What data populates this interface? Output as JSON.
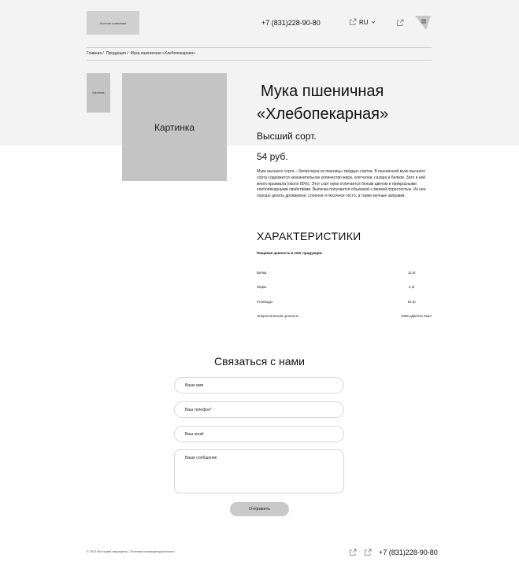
{
  "header": {
    "logo_text": "Логотип компании",
    "phone": "+7 (831)228-90-80",
    "lang": "RU"
  },
  "breadcrumb": {
    "items": [
      "Главная /",
      "Продукция /",
      "Мука пшеничная «Хлебопекарная»"
    ]
  },
  "gallery": {
    "thumb_label": "Картинка",
    "main_label": "Картинка"
  },
  "product": {
    "title_line1": "Мука пшеничная",
    "title_line2": "«Хлебопекарная»",
    "grade": "Высший сорт.",
    "price": "54 руб.",
    "description": "Мука высшего сорта – белая мука из пшеницы твёрдых сортов. В пшеничной муке высшего сорта содержится незначительное количество жира, клетчатки, сахара и белков. Зато в ней много крахмала (около 80%). Этот сорт муки отличается белым цветом и прекрасными хлебопекарными свойствами. Выпечка получается объемной с мелкой пористостью. Из нее хорошо делать дрожжевое, слоеное и песочное тесто, а также мучные заправки."
  },
  "characteristics": {
    "title": "ХАРАКТЕРИСТИКИ",
    "subtitle": "Пищевая ценность в 100г продукции:",
    "rows": [
      {
        "name": "Белки",
        "value": "11,5г"
      },
      {
        "name": "Жиры",
        "value": "2,2г"
      },
      {
        "name": "Углеводы",
        "value": "61,5г"
      },
      {
        "name": "Энергетическая ценность",
        "value": "1306 кДж/312 Ккал"
      }
    ]
  },
  "contact": {
    "title": "Связаться с нами",
    "name_placeholder": "Ваше имя",
    "phone_placeholder": "Ваш телефон*",
    "email_placeholder": "Ваш email",
    "message_placeholder": "Ваше сообщение",
    "submit_label": "Отправить"
  },
  "footer": {
    "copyright": "© 2021 Все права защищены |",
    "privacy": "Политика конфиденциальности",
    "phone": "+7 (831)228-90-80"
  },
  "icons": {
    "external": "external-link-icon",
    "chevron": "chevron-down-icon",
    "menu": "hamburger-menu-icon"
  },
  "colors": {
    "hero_bg": "#f3f3f3",
    "placeholder_gray": "#c4c4c4",
    "button_gray": "#c9c9c9"
  }
}
